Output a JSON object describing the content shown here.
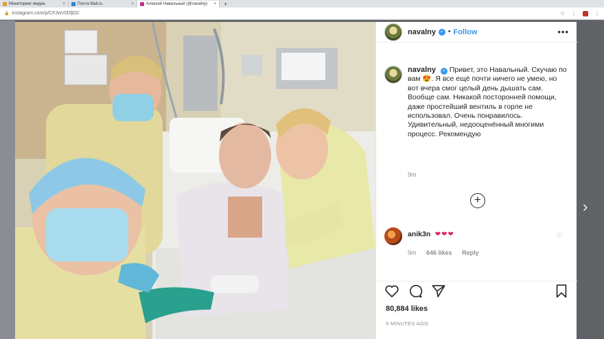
{
  "browser": {
    "tabs": [
      {
        "label": "Мониторинг медиа",
        "favicon_color": "#e0a030",
        "active": false
      },
      {
        "label": "Почта Mail.ru",
        "favicon_color": "#2b88d9",
        "active": false
      },
      {
        "label": "Алексей Навальный (@navalny)",
        "favicon_color": "#c13584",
        "active": true
      }
    ],
    "new_tab": "+",
    "url": "instagram.com/p/CFJwV0Dlj02/"
  },
  "post": {
    "header": {
      "username": "navalny",
      "follow_label": "Follow",
      "more": "•••"
    },
    "caption": {
      "username": "navalny",
      "text": "Привет, это Навальный. Скучаю по вам 😍. Я все ещё почти ничего не умею, но вот вчера смог целый день дышать сам. Вообще сам. Никакой посторонней помощи, даже простейший вентиль в горле не использовал. Очень понравилось. Удивительный, недооценённый многими процесс. Рекомендую",
      "time": "9m"
    },
    "load_more": "+",
    "comment": {
      "username": "anik3n",
      "text": "❤❤❤",
      "time": "9m",
      "likes": "646 likes",
      "reply": "Reply"
    },
    "likes_count": "80,884 likes",
    "posted_ago": "9 MINUTES AGO"
  },
  "colors": {
    "accent": "#3897f0",
    "heart": "#e0245e"
  },
  "icons": [
    "heart-icon",
    "comment-icon",
    "share-icon",
    "bookmark-icon",
    "verified-badge-icon",
    "chevron-right-icon"
  ]
}
